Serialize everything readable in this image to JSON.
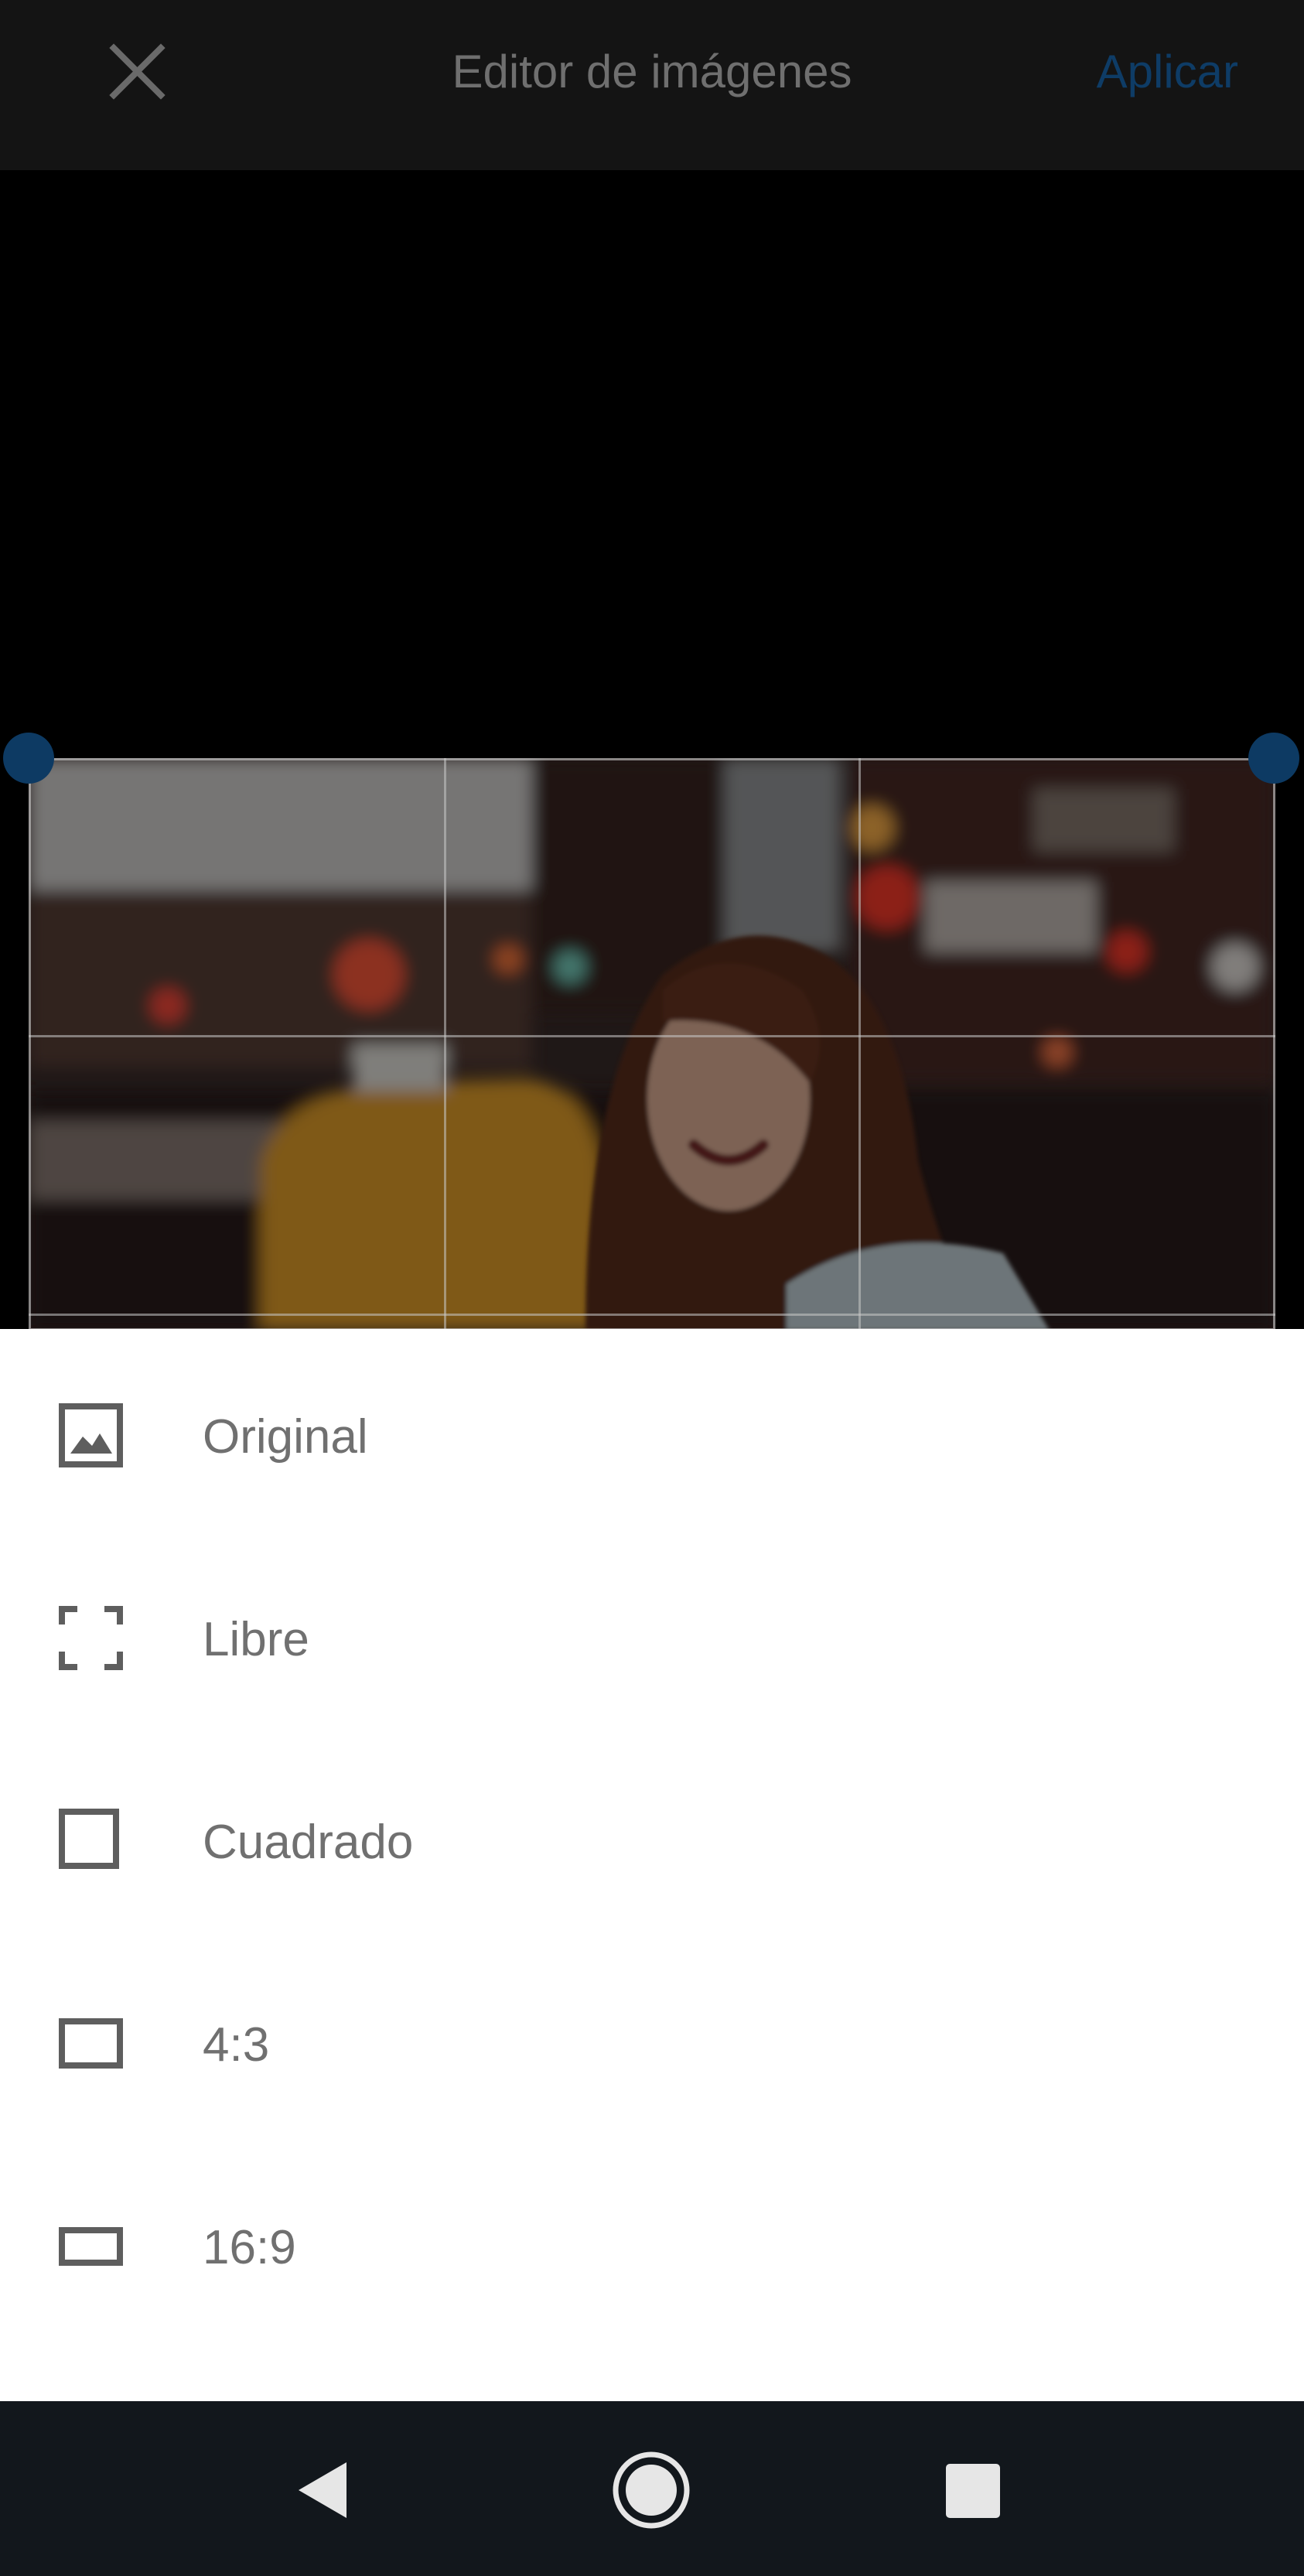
{
  "header": {
    "title": "Editor de imágenes",
    "apply_label": "Aplicar",
    "close_icon": "close-icon"
  },
  "editor": {
    "image_description": "blurred city street at night with yellow taxi and smiling woman",
    "crop_grid": "3x3"
  },
  "aspect_options": [
    {
      "label": "Original",
      "icon": "image-icon"
    },
    {
      "label": "Libre",
      "icon": "free-crop-icon"
    },
    {
      "label": "Cuadrado",
      "icon": "square-icon"
    },
    {
      "label": "4:3",
      "icon": "rect-4-3-icon"
    },
    {
      "label": "16:9",
      "icon": "rect-16-9-icon"
    }
  ],
  "navigation": {
    "back": "back-icon",
    "home": "home-icon",
    "recents": "recents-icon"
  },
  "colors": {
    "accent": "#0e3c66",
    "header_bg": "#141414",
    "sheet_bg": "#ffffff",
    "nav_bg": "#12171c"
  }
}
